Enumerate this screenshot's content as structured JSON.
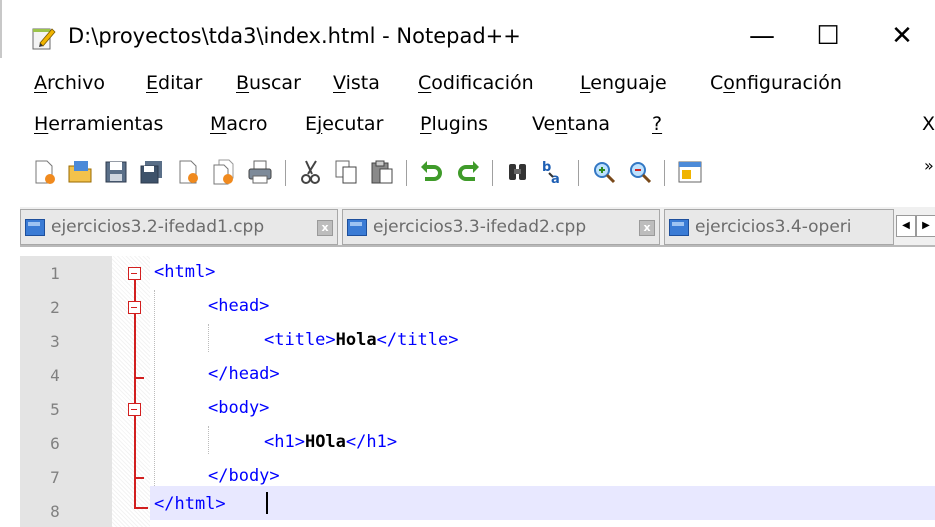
{
  "window": {
    "title": "D:\\proyectos\\tda3\\index.html - Notepad++",
    "minimize": "—",
    "maximize": "☐",
    "close": "✕"
  },
  "menu": {
    "row1": [
      {
        "label": "Archivo",
        "accel": "A"
      },
      {
        "label": "Editar",
        "accel": "E"
      },
      {
        "label": "Buscar",
        "accel": "B"
      },
      {
        "label": "Vista",
        "accel": "V"
      },
      {
        "label": "Codificación",
        "accel": "C"
      },
      {
        "label": "Lenguaje",
        "accel": "L"
      },
      {
        "label": "Configuración",
        "accel": "o"
      }
    ],
    "row2": [
      {
        "label": "Herramientas",
        "accel": "H"
      },
      {
        "label": "Macro",
        "accel": "M"
      },
      {
        "label": "Ejecutar",
        "accel": "j"
      },
      {
        "label": "Plugins",
        "accel": "P"
      },
      {
        "label": "Ventana",
        "accel": "n"
      },
      {
        "label": "?",
        "accel": "?"
      }
    ],
    "close_doc": "X"
  },
  "toolbar": {
    "icons": [
      "new-file-icon",
      "open-file-icon",
      "save-icon",
      "save-all-icon",
      "close-icon",
      "close-all-icon",
      "print-icon",
      "cut-icon",
      "copy-icon",
      "paste-icon",
      "undo-icon",
      "redo-icon",
      "find-icon",
      "replace-icon",
      "zoom-in-icon",
      "zoom-out-icon",
      "sync-scroll-icon"
    ],
    "overflow": "»"
  },
  "tabs": [
    {
      "label": "ejercicios3.2-ifedad1.cpp",
      "close": "x"
    },
    {
      "label": "ejercicios3.3-ifedad2.cpp",
      "close": "x"
    },
    {
      "label": "ejercicios3.4-operi"
    }
  ],
  "tab_scroll": {
    "left": "◀",
    "right": "▶"
  },
  "editor": {
    "lines": [
      {
        "num": "1",
        "parts": [
          "<html>"
        ]
      },
      {
        "num": "2",
        "parts": [
          "<head>"
        ]
      },
      {
        "num": "3",
        "parts": [
          "<title>",
          "Hola",
          "</title>"
        ]
      },
      {
        "num": "4",
        "parts": [
          "</head>"
        ]
      },
      {
        "num": "5",
        "parts": [
          "<body>"
        ]
      },
      {
        "num": "6",
        "parts": [
          "<h1>",
          "HOla",
          "</h1>"
        ]
      },
      {
        "num": "7",
        "parts": [
          "</body>"
        ]
      },
      {
        "num": "8",
        "parts": [
          "</html>"
        ]
      }
    ]
  },
  "colors": {
    "tag": "#0000ff",
    "fold": "#d21f1f",
    "current_line": "#e8e8ff"
  }
}
